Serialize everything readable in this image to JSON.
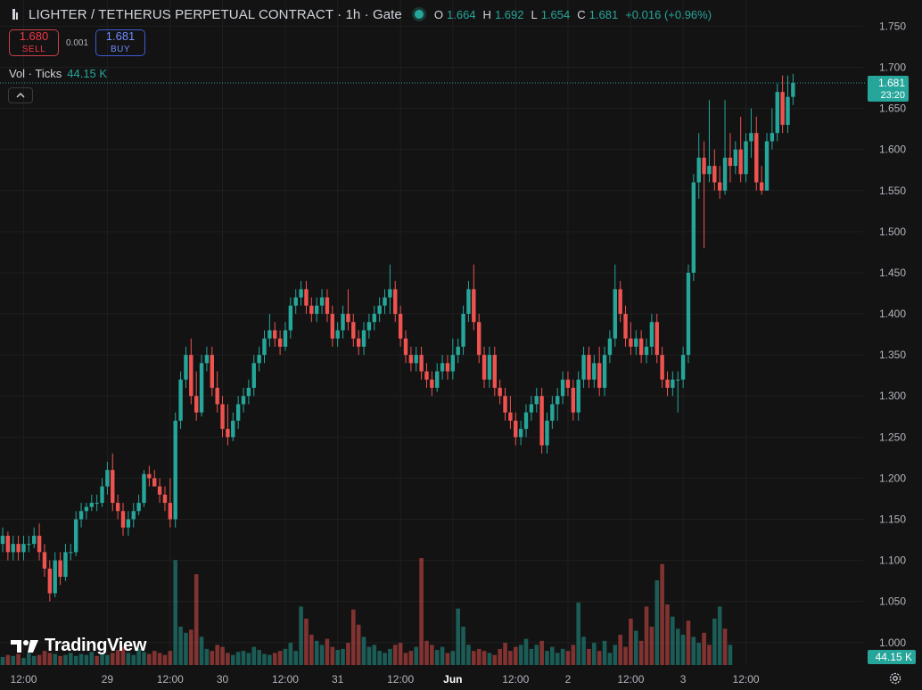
{
  "header": {
    "title": "LIGHTER / TETHERUS PERPETUAL CONTRACT · 1h · Gate",
    "ohlc": {
      "o_label": "O",
      "o": "1.664",
      "h_label": "H",
      "h": "1.692",
      "l_label": "L",
      "l": "1.654",
      "c_label": "C",
      "c": "1.681",
      "change": "+0.016 (+0.96%)"
    }
  },
  "trade": {
    "sell_price": "1.680",
    "sell_label": "SELL",
    "spread": "0.001",
    "buy_price": "1.681",
    "buy_label": "BUY"
  },
  "volume_legend": {
    "label": "Vol · Ticks",
    "value": "44.15 K"
  },
  "watermark": "TradingView",
  "colors": {
    "up": "#26a69a",
    "down": "#ef5350",
    "background": "#131313",
    "grid": "#1f1f1f"
  },
  "chart_data": {
    "type": "candlestick",
    "interval": "1h",
    "y_axis": {
      "ticks": [
        1.75,
        1.7,
        1.65,
        1.6,
        1.55,
        1.5,
        1.45,
        1.4,
        1.35,
        1.3,
        1.25,
        1.2,
        1.15,
        1.1,
        1.05,
        1.0
      ],
      "tick_labels": [
        "1.750",
        "1.700",
        "1.650",
        "1.600",
        "1.550",
        "1.500",
        "1.450",
        "1.400",
        "1.350",
        "1.300",
        "1.250",
        "1.200",
        "1.150",
        "1.100",
        "1.050",
        "1.000"
      ],
      "range": [
        0.99,
        1.758
      ]
    },
    "x_axis": {
      "labels": [
        "12:00",
        "29",
        "12:00",
        "30",
        "12:00",
        "31",
        "12:00",
        "Jun",
        "12:00",
        "2",
        "12:00",
        "3",
        "12:00"
      ],
      "label_bar_index": [
        4,
        20,
        32,
        42,
        54,
        64,
        76,
        86,
        98,
        108,
        120,
        130,
        142
      ],
      "bold": [
        false,
        false,
        false,
        false,
        false,
        false,
        false,
        true,
        false,
        false,
        false,
        false,
        false
      ]
    },
    "last_price": {
      "value": 1.681,
      "label": "1.681",
      "countdown": "23:20"
    },
    "volume_last": {
      "label": "44.15 K"
    },
    "ohlc": [
      [
        1.12,
        1.14,
        1.11,
        1.13
      ],
      [
        1.13,
        1.135,
        1.1,
        1.11
      ],
      [
        1.11,
        1.13,
        1.1,
        1.12
      ],
      [
        1.12,
        1.13,
        1.1,
        1.11
      ],
      [
        1.11,
        1.13,
        1.1,
        1.12
      ],
      [
        1.12,
        1.13,
        1.11,
        1.12
      ],
      [
        1.12,
        1.14,
        1.115,
        1.13
      ],
      [
        1.13,
        1.145,
        1.1,
        1.11
      ],
      [
        1.11,
        1.12,
        1.08,
        1.09
      ],
      [
        1.09,
        1.1,
        1.05,
        1.06
      ],
      [
        1.06,
        1.11,
        1.055,
        1.1
      ],
      [
        1.1,
        1.11,
        1.07,
        1.08
      ],
      [
        1.08,
        1.12,
        1.075,
        1.11
      ],
      [
        1.11,
        1.12,
        1.1,
        1.11
      ],
      [
        1.11,
        1.16,
        1.105,
        1.15
      ],
      [
        1.15,
        1.17,
        1.14,
        1.16
      ],
      [
        1.16,
        1.17,
        1.15,
        1.165
      ],
      [
        1.165,
        1.18,
        1.16,
        1.17
      ],
      [
        1.17,
        1.18,
        1.16,
        1.17
      ],
      [
        1.17,
        1.2,
        1.165,
        1.19
      ],
      [
        1.19,
        1.22,
        1.18,
        1.21
      ],
      [
        1.21,
        1.23,
        1.16,
        1.17
      ],
      [
        1.17,
        1.18,
        1.15,
        1.16
      ],
      [
        1.16,
        1.17,
        1.13,
        1.14
      ],
      [
        1.14,
        1.16,
        1.13,
        1.15
      ],
      [
        1.15,
        1.17,
        1.14,
        1.16
      ],
      [
        1.16,
        1.18,
        1.155,
        1.17
      ],
      [
        1.17,
        1.21,
        1.165,
        1.205
      ],
      [
        1.205,
        1.215,
        1.19,
        1.2
      ],
      [
        1.2,
        1.21,
        1.19,
        1.19
      ],
      [
        1.19,
        1.2,
        1.17,
        1.18
      ],
      [
        1.18,
        1.19,
        1.16,
        1.17
      ],
      [
        1.17,
        1.2,
        1.14,
        1.15
      ],
      [
        1.15,
        1.28,
        1.14,
        1.27
      ],
      [
        1.27,
        1.33,
        1.26,
        1.32
      ],
      [
        1.32,
        1.36,
        1.31,
        1.35
      ],
      [
        1.35,
        1.37,
        1.29,
        1.3
      ],
      [
        1.3,
        1.33,
        1.27,
        1.28
      ],
      [
        1.28,
        1.35,
        1.275,
        1.34
      ],
      [
        1.34,
        1.36,
        1.33,
        1.35
      ],
      [
        1.35,
        1.36,
        1.3,
        1.31
      ],
      [
        1.31,
        1.33,
        1.28,
        1.29
      ],
      [
        1.29,
        1.3,
        1.25,
        1.26
      ],
      [
        1.26,
        1.29,
        1.24,
        1.25
      ],
      [
        1.25,
        1.28,
        1.245,
        1.27
      ],
      [
        1.27,
        1.3,
        1.26,
        1.29
      ],
      [
        1.29,
        1.31,
        1.28,
        1.3
      ],
      [
        1.3,
        1.32,
        1.29,
        1.31
      ],
      [
        1.31,
        1.35,
        1.3,
        1.34
      ],
      [
        1.34,
        1.36,
        1.33,
        1.35
      ],
      [
        1.35,
        1.38,
        1.34,
        1.37
      ],
      [
        1.37,
        1.4,
        1.36,
        1.38
      ],
      [
        1.38,
        1.39,
        1.36,
        1.37
      ],
      [
        1.37,
        1.38,
        1.35,
        1.36
      ],
      [
        1.36,
        1.39,
        1.355,
        1.38
      ],
      [
        1.38,
        1.42,
        1.37,
        1.41
      ],
      [
        1.41,
        1.43,
        1.4,
        1.42
      ],
      [
        1.42,
        1.44,
        1.41,
        1.43
      ],
      [
        1.43,
        1.44,
        1.4,
        1.41
      ],
      [
        1.41,
        1.42,
        1.39,
        1.4
      ],
      [
        1.4,
        1.42,
        1.39,
        1.41
      ],
      [
        1.41,
        1.43,
        1.4,
        1.42
      ],
      [
        1.42,
        1.43,
        1.39,
        1.4
      ],
      [
        1.4,
        1.41,
        1.36,
        1.37
      ],
      [
        1.37,
        1.39,
        1.36,
        1.38
      ],
      [
        1.38,
        1.41,
        1.37,
        1.4
      ],
      [
        1.4,
        1.43,
        1.38,
        1.39
      ],
      [
        1.39,
        1.4,
        1.36,
        1.37
      ],
      [
        1.37,
        1.38,
        1.35,
        1.36
      ],
      [
        1.36,
        1.39,
        1.35,
        1.38
      ],
      [
        1.38,
        1.4,
        1.37,
        1.39
      ],
      [
        1.39,
        1.41,
        1.38,
        1.4
      ],
      [
        1.4,
        1.42,
        1.39,
        1.41
      ],
      [
        1.41,
        1.43,
        1.4,
        1.42
      ],
      [
        1.42,
        1.46,
        1.4,
        1.43
      ],
      [
        1.43,
        1.44,
        1.39,
        1.4
      ],
      [
        1.4,
        1.41,
        1.36,
        1.37
      ],
      [
        1.37,
        1.38,
        1.34,
        1.35
      ],
      [
        1.35,
        1.36,
        1.33,
        1.34
      ],
      [
        1.34,
        1.36,
        1.33,
        1.35
      ],
      [
        1.35,
        1.36,
        1.32,
        1.33
      ],
      [
        1.33,
        1.34,
        1.31,
        1.32
      ],
      [
        1.32,
        1.33,
        1.3,
        1.31
      ],
      [
        1.31,
        1.34,
        1.305,
        1.33
      ],
      [
        1.33,
        1.35,
        1.32,
        1.34
      ],
      [
        1.34,
        1.35,
        1.32,
        1.33
      ],
      [
        1.33,
        1.37,
        1.32,
        1.35
      ],
      [
        1.35,
        1.37,
        1.34,
        1.36
      ],
      [
        1.36,
        1.41,
        1.35,
        1.4
      ],
      [
        1.4,
        1.44,
        1.39,
        1.43
      ],
      [
        1.43,
        1.46,
        1.38,
        1.39
      ],
      [
        1.39,
        1.4,
        1.34,
        1.35
      ],
      [
        1.35,
        1.36,
        1.31,
        1.32
      ],
      [
        1.32,
        1.36,
        1.31,
        1.35
      ],
      [
        1.35,
        1.36,
        1.3,
        1.31
      ],
      [
        1.31,
        1.32,
        1.29,
        1.3
      ],
      [
        1.3,
        1.31,
        1.27,
        1.28
      ],
      [
        1.28,
        1.3,
        1.26,
        1.27
      ],
      [
        1.27,
        1.28,
        1.24,
        1.25
      ],
      [
        1.25,
        1.27,
        1.24,
        1.26
      ],
      [
        1.26,
        1.29,
        1.25,
        1.28
      ],
      [
        1.28,
        1.3,
        1.27,
        1.29
      ],
      [
        1.29,
        1.31,
        1.28,
        1.3
      ],
      [
        1.3,
        1.31,
        1.23,
        1.24
      ],
      [
        1.24,
        1.28,
        1.23,
        1.27
      ],
      [
        1.27,
        1.3,
        1.26,
        1.29
      ],
      [
        1.29,
        1.31,
        1.27,
        1.3
      ],
      [
        1.3,
        1.33,
        1.29,
        1.32
      ],
      [
        1.32,
        1.33,
        1.3,
        1.31
      ],
      [
        1.31,
        1.32,
        1.27,
        1.28
      ],
      [
        1.28,
        1.33,
        1.27,
        1.32
      ],
      [
        1.32,
        1.36,
        1.31,
        1.35
      ],
      [
        1.35,
        1.36,
        1.31,
        1.32
      ],
      [
        1.32,
        1.35,
        1.31,
        1.34
      ],
      [
        1.34,
        1.36,
        1.3,
        1.31
      ],
      [
        1.31,
        1.36,
        1.3,
        1.35
      ],
      [
        1.35,
        1.38,
        1.34,
        1.37
      ],
      [
        1.37,
        1.46,
        1.36,
        1.43
      ],
      [
        1.43,
        1.44,
        1.39,
        1.4
      ],
      [
        1.4,
        1.41,
        1.36,
        1.37
      ],
      [
        1.37,
        1.39,
        1.35,
        1.36
      ],
      [
        1.36,
        1.38,
        1.35,
        1.37
      ],
      [
        1.37,
        1.38,
        1.34,
        1.35
      ],
      [
        1.35,
        1.37,
        1.34,
        1.36
      ],
      [
        1.36,
        1.4,
        1.35,
        1.39
      ],
      [
        1.39,
        1.4,
        1.34,
        1.35
      ],
      [
        1.35,
        1.36,
        1.31,
        1.32
      ],
      [
        1.32,
        1.33,
        1.3,
        1.31
      ],
      [
        1.31,
        1.33,
        1.3,
        1.32
      ],
      [
        1.32,
        1.33,
        1.28,
        1.32
      ],
      [
        1.32,
        1.36,
        1.31,
        1.35
      ],
      [
        1.35,
        1.46,
        1.34,
        1.45
      ],
      [
        1.45,
        1.57,
        1.44,
        1.56
      ],
      [
        1.56,
        1.62,
        1.54,
        1.59
      ],
      [
        1.59,
        1.61,
        1.48,
        1.57
      ],
      [
        1.57,
        1.66,
        1.56,
        1.58
      ],
      [
        1.58,
        1.6,
        1.55,
        1.56
      ],
      [
        1.56,
        1.58,
        1.54,
        1.55
      ],
      [
        1.55,
        1.66,
        1.545,
        1.59
      ],
      [
        1.59,
        1.62,
        1.56,
        1.58
      ],
      [
        1.58,
        1.61,
        1.57,
        1.6
      ],
      [
        1.6,
        1.64,
        1.56,
        1.57
      ],
      [
        1.57,
        1.62,
        1.56,
        1.61
      ],
      [
        1.61,
        1.65,
        1.59,
        1.62
      ],
      [
        1.62,
        1.64,
        1.55,
        1.56
      ],
      [
        1.56,
        1.58,
        1.545,
        1.55
      ],
      [
        1.55,
        1.62,
        1.55,
        1.61
      ],
      [
        1.61,
        1.65,
        1.6,
        1.62
      ],
      [
        1.62,
        1.68,
        1.61,
        1.67
      ],
      [
        1.67,
        1.69,
        1.62,
        1.63
      ],
      [
        1.63,
        1.69,
        1.62,
        1.664
      ],
      [
        1.664,
        1.692,
        1.654,
        1.681
      ]
    ],
    "volume": [
      8,
      10,
      9,
      11,
      7,
      12,
      9,
      10,
      14,
      12,
      11,
      9,
      10,
      12,
      9,
      11,
      10,
      13,
      9,
      11,
      10,
      12,
      15,
      18,
      12,
      10,
      16,
      13,
      11,
      14,
      12,
      10,
      14,
      104,
      38,
      32,
      35,
      90,
      28,
      16,
      14,
      20,
      18,
      12,
      10,
      13,
      14,
      12,
      18,
      15,
      11,
      10,
      12,
      14,
      16,
      22,
      14,
      58,
      46,
      30,
      24,
      20,
      26,
      18,
      15,
      16,
      22,
      55,
      40,
      28,
      18,
      20,
      14,
      12,
      16,
      20,
      22,
      12,
      14,
      18,
      106,
      24,
      20,
      15,
      18,
      12,
      14,
      56,
      38,
      20,
      14,
      16,
      14,
      12,
      10,
      16,
      22,
      14,
      18,
      20,
      26,
      16,
      20,
      24,
      14,
      18,
      12,
      16,
      14,
      20,
      62,
      28,
      16,
      22,
      14,
      24,
      12,
      20,
      30,
      18,
      46,
      34,
      24,
      58,
      38,
      84,
      100,
      60,
      48,
      36,
      30,
      44,
      28,
      22,
      32,
      20,
      46,
      58,
      36,
      20
    ],
    "volume_up": [
      true,
      false,
      true,
      false,
      true,
      true,
      true,
      false,
      false,
      false,
      true,
      false,
      true,
      true,
      true,
      true,
      true,
      true,
      false,
      true,
      true,
      false,
      false,
      false,
      true,
      true,
      true,
      true,
      false,
      false,
      false,
      false,
      false,
      true,
      true,
      true,
      false,
      false,
      true,
      true,
      false,
      false,
      false,
      false,
      true,
      true,
      true,
      true,
      true,
      true,
      true,
      true,
      false,
      false,
      true,
      true,
      true,
      true,
      false,
      false,
      true,
      true,
      false,
      false,
      true,
      true,
      false,
      false,
      false,
      true,
      true,
      true,
      true,
      true,
      true,
      false,
      false,
      false,
      false,
      true,
      false,
      false,
      false,
      true,
      true,
      false,
      true,
      true,
      true,
      true,
      false,
      false,
      false,
      true,
      false,
      false,
      false,
      false,
      false,
      true,
      true,
      true,
      true,
      false,
      true,
      true,
      true,
      true,
      false,
      false,
      true,
      true,
      false,
      true,
      false,
      true,
      true,
      true,
      false,
      false,
      false,
      true,
      false,
      false,
      false,
      true,
      false,
      false,
      true,
      true,
      true,
      false,
      true,
      true,
      false,
      false,
      true,
      true,
      false,
      true
    ]
  }
}
